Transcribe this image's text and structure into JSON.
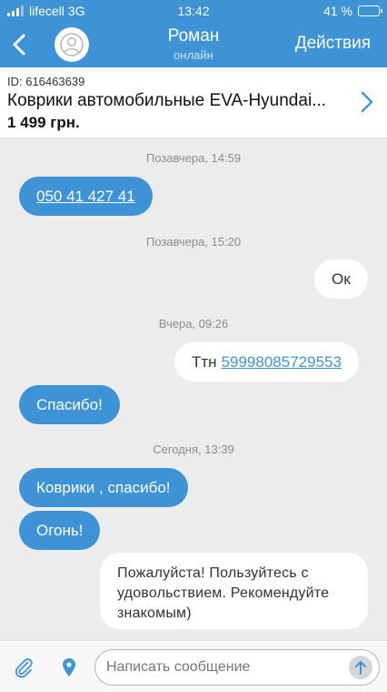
{
  "status_bar": {
    "carrier": "lifecell 3G",
    "time": "13:42",
    "battery": "41 %",
    "battery_level": 0.41
  },
  "header": {
    "title": "Роман",
    "subtitle": "онлайн",
    "actions_label": "Действия"
  },
  "product": {
    "id": "ID: 616463639",
    "name": "Коврики автомобильные EVA-Hyundai...",
    "price": "1 499 грн."
  },
  "messages": {
    "date1": "Позавчера, 14:59",
    "msg1": "050 41 427 41",
    "date2": "Позавчера, 15:20",
    "msg2": "Ок",
    "date3": "Вчера, 09:26",
    "msg3_prefix": "Ттн",
    "msg3_link": "59998085729553",
    "msg4": "Спасибо!",
    "date4": "Сегодня, 13:39",
    "msg5": "Коврики , спасибо!",
    "msg6": "Огонь!",
    "msg7_line1": "Пожалуйста! Пользуйтесь с",
    "msg7_line2": "удовольствием. Рекомендуйте",
    "msg7_line3": "знакомым)"
  },
  "composer": {
    "placeholder": "Написать сообщение"
  },
  "colors": {
    "accent": "#3e93d6",
    "background": "#ececec"
  }
}
